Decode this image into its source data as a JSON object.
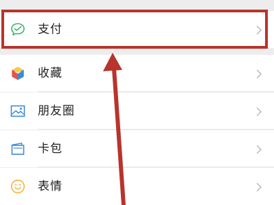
{
  "menu": {
    "items": [
      {
        "label": "支付",
        "icon": "wallet-check-icon",
        "color": "#3cb371"
      },
      {
        "label": "收藏",
        "icon": "cube-icon",
        "color": "#f4b53f"
      },
      {
        "label": "朋友圈",
        "icon": "image-icon",
        "color": "#3d89d8"
      },
      {
        "label": "卡包",
        "icon": "card-pack-icon",
        "color": "#3d89d8"
      },
      {
        "label": "表情",
        "icon": "smiley-icon",
        "color": "#f4b53f"
      }
    ]
  },
  "annotation": {
    "highlight_color": "#b8342c",
    "arrow_color": "#b8342c"
  }
}
